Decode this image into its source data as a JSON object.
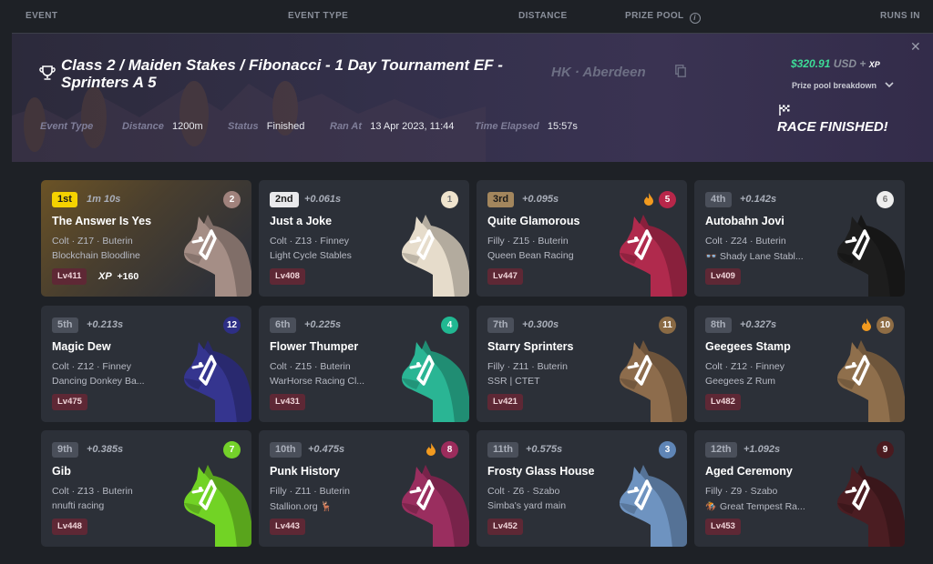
{
  "columns": {
    "event": "EVENT",
    "event_type": "EVENT TYPE",
    "distance": "DISTANCE",
    "prize_pool": "PRIZE POOL",
    "runs_in": "RUNS IN"
  },
  "event": {
    "title": "Class 2 / Maiden Stakes / Fibonacci - 1 Day Tournament EF - Sprinters A 5",
    "location": "HK · Aberdeen",
    "event_type_label": "Event Type",
    "distance_label": "Distance",
    "distance": "1200m",
    "status_label": "Status",
    "status": "Finished",
    "ran_at_label": "Ran At",
    "ran_at": "13 Apr 2023, 11:44",
    "time_elapsed_label": "Time Elapsed",
    "time_elapsed": "15:57s",
    "prize_amount": "$320.91",
    "prize_currency": "USD +",
    "prize_xp": "XP",
    "prize_breakdown": "Prize pool breakdown",
    "race_status": "RACE FINISHED!"
  },
  "runners": [
    {
      "place": "1st",
      "gap": "1m 10s",
      "gate": "2",
      "gate_color": "#a0827c",
      "name": "The Answer Is Yes",
      "desc": "Colt · Z17 · Buterin",
      "stable": "Blockchain Bloodline",
      "level": "Lv411",
      "xp_label": "XP",
      "xp_gain": "+160",
      "coat": "#a58e86",
      "flame": false
    },
    {
      "place": "2nd",
      "gap": "+0.061s",
      "gate": "1",
      "gate_color": "#efe3cd",
      "name": "Just a Joke",
      "desc": "Colt · Z13 · Finney",
      "stable": "Light Cycle Stables",
      "level": "Lv408",
      "coat": "#e6dccb",
      "flame": false
    },
    {
      "place": "3rd",
      "gap": "+0.095s",
      "gate": "5",
      "gate_color": "#b8274a",
      "name": "Quite Glamorous",
      "desc": "Filly · Z15 · Buterin",
      "stable": "Queen Bean Racing",
      "level": "Lv447",
      "coat": "#b02a4d",
      "flame": true
    },
    {
      "place": "4th",
      "gap": "+0.142s",
      "gate": "6",
      "gate_color": "#eeeeee",
      "name": "Autobahn Jovi",
      "desc": "Colt · Z24 · Buterin",
      "stable": "👓 Shady Lane Stabl...",
      "level": "Lv409",
      "coat": "#1d1d1d",
      "flame": false
    },
    {
      "place": "5th",
      "gap": "+0.213s",
      "gate": "12",
      "gate_color": "#2e2f86",
      "name": "Magic Dew",
      "desc": "Colt · Z12 · Finney",
      "stable": "Dancing Donkey Ba...",
      "level": "Lv475",
      "coat": "#35358f",
      "flame": false
    },
    {
      "place": "6th",
      "gap": "+0.225s",
      "gate": "4",
      "gate_color": "#21b892",
      "name": "Flower Thumper",
      "desc": "Colt · Z15 · Buterin",
      "stable": "WarHorse Racing Cl...",
      "level": "Lv431",
      "coat": "#2ab594",
      "flame": false
    },
    {
      "place": "7th",
      "gap": "+0.300s",
      "gate": "11",
      "gate_color": "#8a6a44",
      "name": "Starry Sprinters",
      "desc": "Filly · Z11 · Buterin",
      "stable": "SSR | CTET",
      "level": "Lv421",
      "coat": "#8d6c4c",
      "flame": false
    },
    {
      "place": "8th",
      "gap": "+0.327s",
      "gate": "10",
      "gate_color": "#8f6d45",
      "name": "Geegees Stamp",
      "desc": "Colt · Z12 · Finney",
      "stable": "Geegees Z Rum",
      "level": "Lv482",
      "coat": "#8f6f4c",
      "flame": true
    },
    {
      "place": "9th",
      "gap": "+0.385s",
      "gate": "7",
      "gate_color": "#74d12a",
      "name": "Gib",
      "desc": "Colt · Z13 · Buterin",
      "stable": "nnufti racing",
      "level": "Lv448",
      "coat": "#72d325",
      "flame": false
    },
    {
      "place": "10th",
      "gap": "+0.475s",
      "gate": "8",
      "gate_color": "#9c2c5c",
      "name": "Punk History",
      "desc": "Filly · Z11 · Buterin",
      "stable": "Stallion.org 🦌",
      "level": "Lv443",
      "coat": "#9a2e5f",
      "flame": true
    },
    {
      "place": "11th",
      "gap": "+0.575s",
      "gate": "3",
      "gate_color": "#5f85b6",
      "name": "Frosty Glass House",
      "desc": "Colt · Z6 · Szabo",
      "stable": "Simba's yard main",
      "level": "Lv452",
      "coat": "#6e93c0",
      "flame": false
    },
    {
      "place": "12th",
      "gap": "+1.092s",
      "gate": "9",
      "gate_color": "#4a1a1f",
      "name": "Aged Ceremony",
      "desc": "Filly · Z9 · Szabo",
      "stable": "🏇 Great Tempest Ra...",
      "level": "Lv453",
      "coat": "#4b1d22",
      "flame": false
    }
  ]
}
